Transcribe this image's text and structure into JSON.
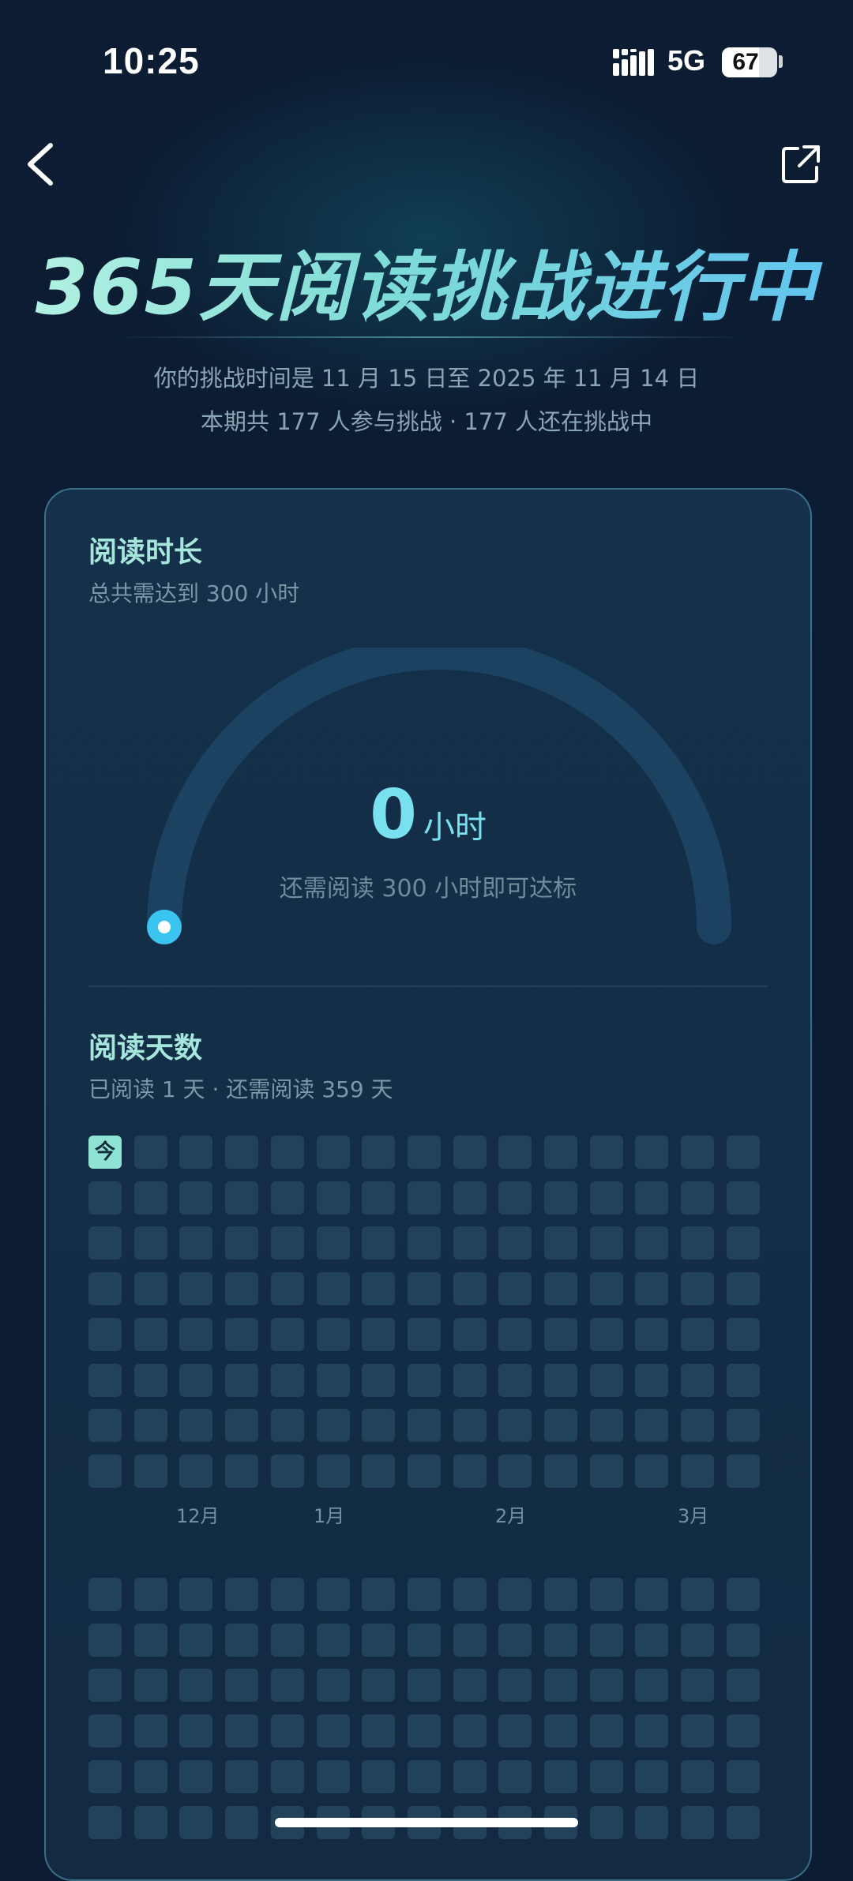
{
  "status_bar": {
    "time": "10:25",
    "network": "5G",
    "battery": "67",
    "battery_level": 0.67
  },
  "header": {
    "title": "365天阅读挑战进行中",
    "period_line": "你的挑战时间是 11 月 15 日至 2025 年 11 月 14 日",
    "participants_line": "本期共 177 人参与挑战 · 177 人还在挑战中"
  },
  "reading_time": {
    "title": "阅读时长",
    "subtitle": "总共需达到 300 小时",
    "value": "0",
    "unit": "小时",
    "hint": "还需阅读 300 小时即可达标",
    "progress": 0
  },
  "reading_days": {
    "title": "阅读天数",
    "subtitle": "已阅读 1 天 · 还需阅读 359 天",
    "today_label": "今",
    "months": [
      "12月",
      "1月",
      "2月",
      "3月"
    ]
  },
  "colors": {
    "accent": "#78e0ef",
    "today_cell": "#8fe3d3",
    "empty_cell": "#22415a",
    "track": "#1b4361"
  }
}
